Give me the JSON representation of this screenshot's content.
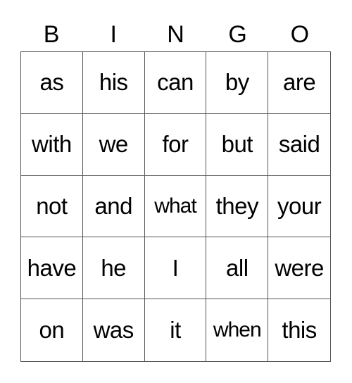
{
  "header": [
    "B",
    "I",
    "N",
    "G",
    "O"
  ],
  "cells": [
    [
      "as",
      "his",
      "can",
      "by",
      "are"
    ],
    [
      "with",
      "we",
      "for",
      "but",
      "said"
    ],
    [
      "not",
      "and",
      "what",
      "they",
      "your"
    ],
    [
      "have",
      "he",
      "I",
      "all",
      "were"
    ],
    [
      "on",
      "was",
      "it",
      "when",
      "this"
    ]
  ]
}
